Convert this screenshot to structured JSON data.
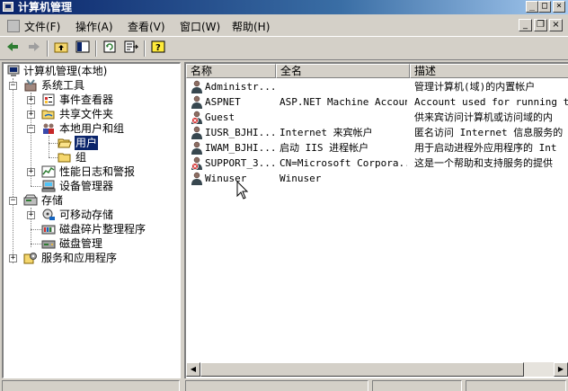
{
  "window": {
    "title": "计算机管理",
    "controls": {
      "minimize": "_",
      "maximize": "□",
      "close": "×"
    },
    "mdi_controls": {
      "minimize": "_",
      "restore": "❐",
      "close": "×"
    }
  },
  "menu": [
    {
      "label": "文件(F)"
    },
    {
      "label": "操作(A)"
    },
    {
      "label": "查看(V)"
    },
    {
      "label": "窗口(W)"
    },
    {
      "label": "帮助(H)"
    }
  ],
  "toolbar": {
    "icons": [
      "back-arrow-icon",
      "forward-arrow-icon",
      "up-folder-icon",
      "show-hide-tree-icon",
      "refresh-icon",
      "export-list-icon",
      "help-icon"
    ]
  },
  "tree": {
    "root": "计算机管理(本地)",
    "system_tools": "系统工具",
    "event_viewer": "事件查看器",
    "shared_folders": "共享文件夹",
    "local_users": "本地用户和组",
    "users": "用户",
    "groups": "组",
    "perf_logs": "性能日志和警报",
    "device_manager": "设备管理器",
    "storage": "存储",
    "removable": "可移动存储",
    "defrag": "磁盘碎片整理程序",
    "disk_mgmt": "磁盘管理",
    "services": "服务和应用程序",
    "expand_plus": "+",
    "expand_minus": "−"
  },
  "list": {
    "columns": {
      "name": "名称",
      "fullname": "全名",
      "desc": "描述"
    },
    "rows": [
      {
        "name": "Administr...",
        "fullname": "",
        "desc": "管理计算机(域)的内置帐户",
        "disabled": false
      },
      {
        "name": "ASPNET",
        "fullname": "ASP.NET Machine Account",
        "desc": "Account used for running the",
        "disabled": false
      },
      {
        "name": "Guest",
        "fullname": "",
        "desc": "供来宾访问计算机或访问域的内",
        "disabled": true
      },
      {
        "name": "IUSR_BJHI...",
        "fullname": "Internet 来宾帐户",
        "desc": "匿名访问 Internet 信息服务的",
        "disabled": false
      },
      {
        "name": "IWAM_BJHI...",
        "fullname": "启动 IIS 进程帐户",
        "desc": "用于启动进程外应用程序的 Int",
        "disabled": false
      },
      {
        "name": "SUPPORT_3...",
        "fullname": "CN=Microsoft Corpora...",
        "desc": "这是一个帮助和支持服务的提供",
        "disabled": true
      },
      {
        "name": "Winuser",
        "fullname": "Winuser",
        "desc": "",
        "disabled": false
      }
    ]
  },
  "scrollbar": {
    "left_arrow": "◀",
    "right_arrow": "▶"
  },
  "colors": {
    "title_start": "#0a246a",
    "title_end": "#a6caf0",
    "selection": "#0a246a",
    "face": "#d4d0c8"
  }
}
